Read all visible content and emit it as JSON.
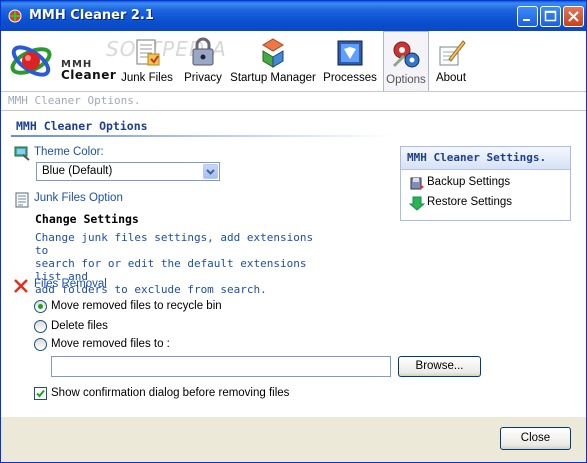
{
  "window": {
    "title": "MMH Cleaner 2.1"
  },
  "logo": {
    "line1": "MMH",
    "line2": "Cleaner"
  },
  "watermark": "SOFTPEDIA",
  "tabs": [
    {
      "label": "Junk Files",
      "icon": "junk-files-icon"
    },
    {
      "label": "Privacy",
      "icon": "privacy-icon"
    },
    {
      "label": "Startup Manager",
      "icon": "startup-manager-icon"
    },
    {
      "label": "Processes",
      "icon": "processes-icon"
    },
    {
      "label": "Options",
      "icon": "options-icon",
      "active": true
    },
    {
      "label": "About",
      "icon": "about-icon"
    }
  ],
  "subline": "MMH Cleaner Options.",
  "section": {
    "title": "MMH Cleaner Options"
  },
  "theme": {
    "label": "Theme Color:",
    "selected": "Blue (Default)"
  },
  "junk": {
    "label": "Junk Files Option",
    "heading": "Change Settings",
    "lines": [
      "Change junk files settings, add extensions to",
      "search for or edit the default extensions list and",
      "add folders to exclude from search."
    ]
  },
  "removal": {
    "label": "Files Removal",
    "options": [
      {
        "label": "Move removed files to recycle bin",
        "selected": true
      },
      {
        "label": "Delete files",
        "selected": false
      },
      {
        "label": "Move removed files to :",
        "selected": false
      }
    ],
    "path_value": "",
    "browse_label": "Browse...",
    "confirm_label": "Show confirmation dialog before removing files",
    "confirm_checked": true
  },
  "panel": {
    "title": "MMH Cleaner Settings.",
    "backup_label": "Backup Settings",
    "restore_label": "Restore Settings"
  },
  "footer": {
    "close_label": "Close"
  },
  "colors": {
    "accent": "#1d4fa8",
    "title_bar": "#0a4fcf",
    "heading": "#1e3f8a"
  }
}
